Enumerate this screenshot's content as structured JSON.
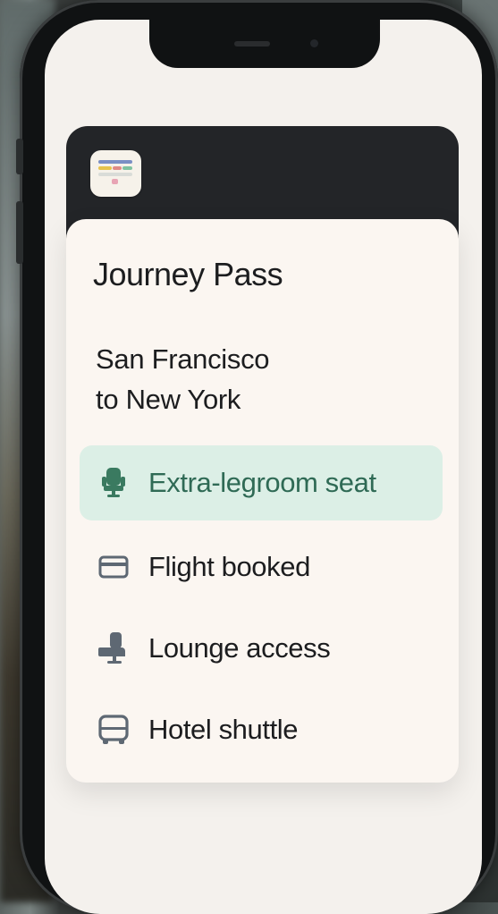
{
  "pass": {
    "title": "Journey Pass",
    "route_line1": "San Francisco",
    "route_line2": "to New York"
  },
  "items": [
    {
      "label": "Extra-legroom seat",
      "icon": "seat-icon",
      "selected": true
    },
    {
      "label": "Flight booked",
      "icon": "card-icon",
      "selected": false
    },
    {
      "label": "Lounge access",
      "icon": "lounge-chair-icon",
      "selected": false
    },
    {
      "label": "Hotel shuttle",
      "icon": "bus-icon",
      "selected": false
    }
  ],
  "colors": {
    "accent_bg": "#dcefe6",
    "accent_fg": "#2f6a55",
    "icon_gray": "#5e6873",
    "header_dark": "#232528",
    "card_bg": "#fbf6f1"
  }
}
